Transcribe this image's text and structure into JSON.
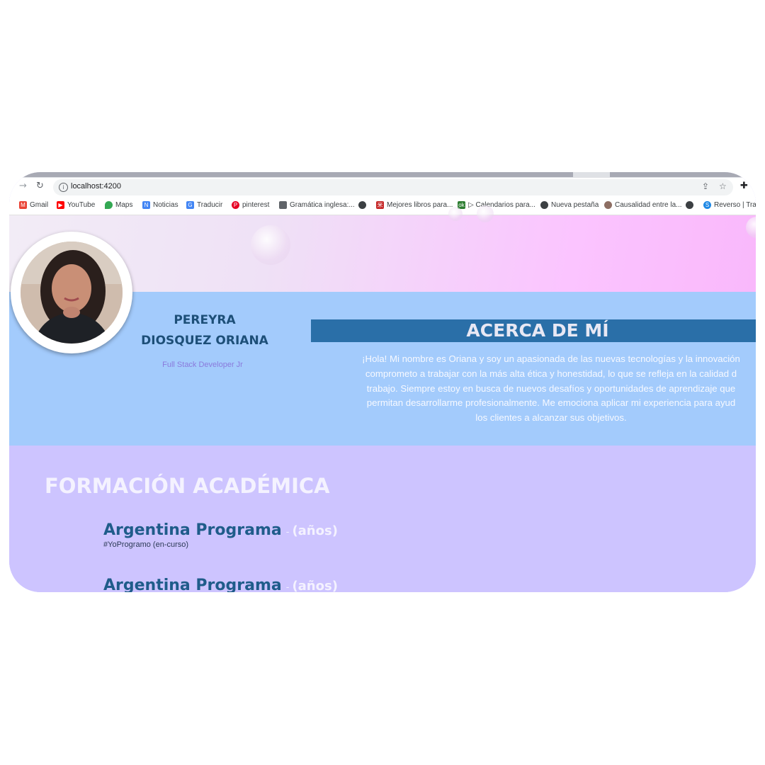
{
  "browser": {
    "url": "localhost:4200",
    "bookmarks": [
      {
        "label": "Gmail",
        "icon": "gmail-icon",
        "color": "#ea4335"
      },
      {
        "label": "YouTube",
        "icon": "youtube-icon",
        "color": "#ff0000"
      },
      {
        "label": "Maps",
        "icon": "maps-icon",
        "color": "#34a853"
      },
      {
        "label": "Noticias",
        "icon": "news-icon",
        "color": "#4285f4"
      },
      {
        "label": "Traducir",
        "icon": "translate-icon",
        "color": "#4285f4"
      },
      {
        "label": "pinterest",
        "icon": "pinterest-icon",
        "color": "#e60023"
      },
      {
        "label": "Gramática inglesa:...",
        "icon": "page-icon",
        "color": "#5f6368"
      },
      {
        "label": "",
        "icon": "globe-icon",
        "color": "#3c4043"
      },
      {
        "label": "Mejores libros para...",
        "icon": "book-icon",
        "color": "#c62828"
      },
      {
        "label": "▷ Calendarios para...",
        "icon": "calendar-icon",
        "color": "#2e7d32"
      },
      {
        "label": "Nueva pestaña",
        "icon": "globe-icon",
        "color": "#3c4043"
      },
      {
        "label": "Causalidad entre la...",
        "icon": "page-icon",
        "color": "#8d6e63"
      },
      {
        "label": "",
        "icon": "globe-icon",
        "color": "#3c4043"
      },
      {
        "label": "Reverso | Trad",
        "icon": "reverso-icon",
        "color": "#1e88e5"
      }
    ]
  },
  "profile": {
    "last_name": "PEREYRA",
    "first_name": "DIOSQUEZ ORIANA",
    "role": "Full Stack Developer Jr"
  },
  "about": {
    "title": "ACERCA DE MÍ",
    "lines": [
      "¡Hola! Mi nombre es Oriana y soy un apasionada de las nuevas tecnologías y la innovación",
      "comprometo a trabajar con la más alta ética y honestidad, lo que se refleja en la calidad d",
      "trabajo. Siempre estoy en busca de nuevos desafíos y oportunidades de aprendizaje que",
      "permitan desarrollarme profesionalmente. Me emociona aplicar mi experiencia para ayud",
      "los clientes a alcanzar sus objetivos."
    ]
  },
  "education": {
    "title": "FORMACIÓN ACADÉMICA",
    "items": [
      {
        "institution": "Argentina Programa",
        "separator": "-",
        "years": "(años)",
        "description": "#YoProgramo (en-curso)"
      },
      {
        "institution": "Argentina Programa",
        "separator": "-",
        "years": "(años)",
        "description": ""
      }
    ]
  },
  "colors": {
    "about_band": "#a3cbfc",
    "about_header": "#2a6fa8",
    "education_band": "#cdc4ff",
    "name_text": "#1d4f78",
    "role_text": "#8a7adc"
  }
}
